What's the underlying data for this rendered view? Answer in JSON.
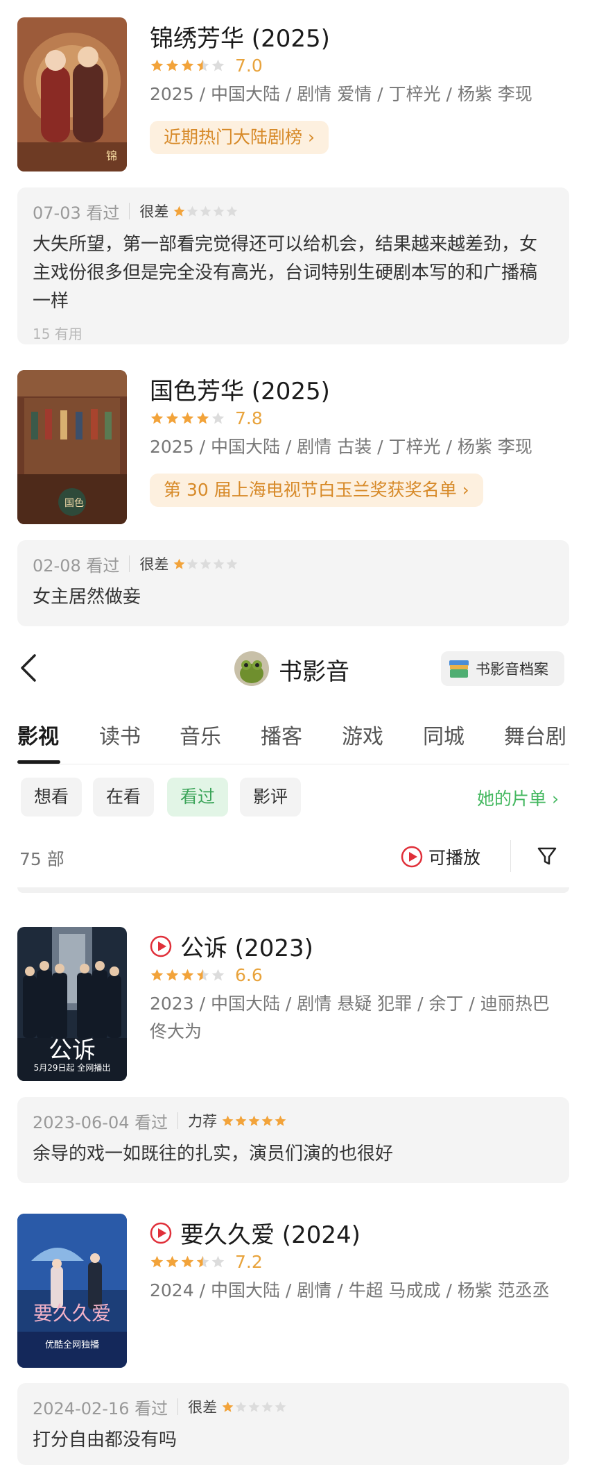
{
  "colors": {
    "star_on": "#f2a33a",
    "star_off": "#dcdcdc",
    "accent_green": "#42b75e",
    "tag_bg": "#fdf0df",
    "tag_text": "#d78a29",
    "play_red": "#e0303a"
  },
  "items": [
    {
      "title": "锦绣芳华 (2025)",
      "rating_stars": 3.5,
      "score": "7.0",
      "meta": "2025 / 中国大陆 / 剧情 爱情 / 丁梓光 / 杨紫 李现",
      "tag": "近期热门大陆剧榜 ›",
      "playable": false,
      "review": {
        "date": "07-03 看过",
        "grade": "很差",
        "stars": 1,
        "text": "大失所望，第一部看完觉得还可以给机会，结果越来越差劲，女主戏份很多但是完全没有高光，台词特别生硬剧本写的和广播稿一样",
        "useful": "15 有用"
      }
    },
    {
      "title": "国色芳华 (2025)",
      "rating_stars": 4,
      "score": "7.8",
      "meta": "2025 / 中国大陆 / 剧情 古装 / 丁梓光 / 杨紫 李现",
      "tag": "第 30 届上海电视节白玉兰奖获奖名单 ›",
      "playable": false,
      "review": {
        "date": "02-08 看过",
        "grade": "很差",
        "stars": 1,
        "text": "女主居然做妾",
        "useful": ""
      }
    },
    {
      "title": "公诉 (2023)",
      "rating_stars": 3.5,
      "score": "6.6",
      "meta": "2023 / 中国大陆 / 剧情 悬疑 犯罪 / 余丁 / 迪丽热巴 佟大为",
      "tag": "",
      "playable": true,
      "poster_text": "公诉",
      "poster_sub": "5月29日起 全网播出",
      "review": {
        "date": "2023-06-04 看过",
        "grade": "力荐",
        "stars": 5,
        "text": "余导的戏一如既往的扎实，演员们演的也很好",
        "useful": ""
      }
    },
    {
      "title": "要久久爱 (2024)",
      "rating_stars": 3.5,
      "score": "7.2",
      "meta": "2024 / 中国大陆 / 剧情 / 牛超 马成成 / 杨紫 范丞丞",
      "tag": "",
      "playable": true,
      "poster_text": "要久久爱",
      "poster_sub": "优酷全网独播",
      "review": {
        "date": "2024-02-16 看过",
        "grade": "很差",
        "stars": 1,
        "text": "打分自由都没有吗",
        "useful": ""
      }
    }
  ],
  "header": {
    "back_icon": "chevron-left-icon",
    "title": "书影音",
    "archive_button": "书影音档案"
  },
  "tabs": [
    "影视",
    "读书",
    "音乐",
    "播客",
    "游戏",
    "同城",
    "舞台剧"
  ],
  "active_tab": "影视",
  "filters": [
    "想看",
    "在看",
    "看过",
    "影评"
  ],
  "active_filter": "看过",
  "her_list_link": "她的片单 ›",
  "count": "75 部",
  "playable_toggle": "可播放",
  "filter_icon": "funnel-icon"
}
